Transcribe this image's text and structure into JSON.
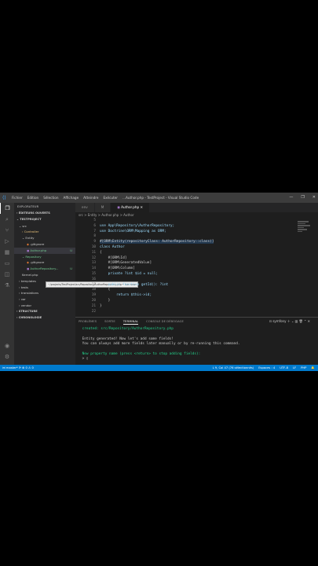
{
  "window": {
    "title": "Author.php - TestProject - Visual Studio Code",
    "menu": [
      "Fichier",
      "Edition",
      "Sélection",
      "Affichage",
      "Atteindre",
      "Exécuter",
      "..."
    ],
    "controls": [
      "—",
      "❐",
      "✕"
    ]
  },
  "activity_icons": [
    "files-icon",
    "search-icon",
    "source-control-icon",
    "run-debug-icon",
    "extensions-icon",
    "remote-icon",
    "database-icon",
    "test-icon"
  ],
  "sidebar": {
    "header": "EXPLORATEUR",
    "open_editors": "ÉDITEURS OUVERTS",
    "project": "TESTPROJECT",
    "items": [
      {
        "label": "src",
        "status": ""
      },
      {
        "label": "Controller",
        "status": ""
      },
      {
        "label": "Entity",
        "status": ""
      },
      {
        "label": ".gitignore",
        "status": ""
      },
      {
        "label": "Author.php",
        "status": "U"
      },
      {
        "label": "Repository",
        "status": ""
      },
      {
        "label": ".gitignore",
        "status": ""
      },
      {
        "label": "AuthorRepository...",
        "status": "U"
      },
      {
        "label": "Kernel.php",
        "status": ""
      },
      {
        "label": "templates",
        "status": ""
      },
      {
        "label": "tests",
        "status": ""
      },
      {
        "label": "translations",
        "status": ""
      },
      {
        "label": "var",
        "status": ""
      },
      {
        "label": "vendor",
        "status": ""
      }
    ],
    "structure": "STRUCTURE",
    "chronologie": "CHRONOLOGIE",
    "tooltip": "~/projects/TestProject/src/Repository/AuthorRepository.php • Non suivi"
  },
  "tabs": [
    {
      "label": "env"
    },
    {
      "label": "M"
    },
    {
      "label": "Author.php"
    }
  ],
  "breadcrumbs": "src > Entity > Author.php > Author",
  "editor": {
    "lines": [
      {
        "n": "5",
        "code": ""
      },
      {
        "n": "6",
        "code": "use App\\Repository\\AuthorRepository;"
      },
      {
        "n": "7",
        "code": "use Doctrine\\ORM\\Mapping as ORM;"
      },
      {
        "n": "8",
        "code": ""
      },
      {
        "n": "9",
        "code": "#[ORM\\Entity(repositoryClass: AuthorRepository::class)]"
      },
      {
        "n": "10",
        "code": "class Author"
      },
      {
        "n": "11",
        "code": "{"
      },
      {
        "n": "12",
        "code": "    #[ORM\\Id]"
      },
      {
        "n": "13",
        "code": "    #[ORM\\GeneratedValue]"
      },
      {
        "n": "14",
        "code": "    #[ORM\\Column]"
      },
      {
        "n": "15",
        "code": "    private ?int $id = null;"
      },
      {
        "n": "16",
        "code": ""
      },
      {
        "n": "17",
        "code": "    public function getId(): ?int"
      },
      {
        "n": "18",
        "code": "    {"
      },
      {
        "n": "19",
        "code": "        return $this->id;"
      },
      {
        "n": "20",
        "code": "    }"
      },
      {
        "n": "21",
        "code": "}"
      },
      {
        "n": "22",
        "code": ""
      }
    ]
  },
  "panel": {
    "tabs": [
      "PROBLÈMES",
      "SORTIE",
      "TERMINAL",
      "CONSOLE DE DÉBOGAGE"
    ],
    "active_tab": "TERMINAL",
    "shell": "symfony",
    "terminal": [
      {
        "text": " created: src/Repository/AuthorRepository.php",
        "color": "green"
      },
      {
        "text": "",
        "color": ""
      },
      {
        "text": " Entity generated! Now let's add some fields!",
        "color": ""
      },
      {
        "text": " You can always add more fields later manually or by re-running this command.",
        "color": ""
      },
      {
        "text": "",
        "color": ""
      },
      {
        "text": " New property name (press <return> to stop adding fields):",
        "color": "green"
      },
      {
        "text": " > ▯",
        "color": ""
      }
    ]
  },
  "statusbar": {
    "branch": "master*",
    "sync": "⟳ ⊗ 0 ⚠ 0",
    "position": "L 9, Col 47 (76 sélectionnés)",
    "spaces": "Espaces : 4",
    "encoding": "UTF-8",
    "eol": "LF",
    "language": "PHP",
    "extra": "🔔"
  },
  "colors": {
    "accent": "#007acc",
    "editor_bg": "#1e1e1e",
    "sidebar_bg": "#252526",
    "activity_bg": "#333333"
  }
}
